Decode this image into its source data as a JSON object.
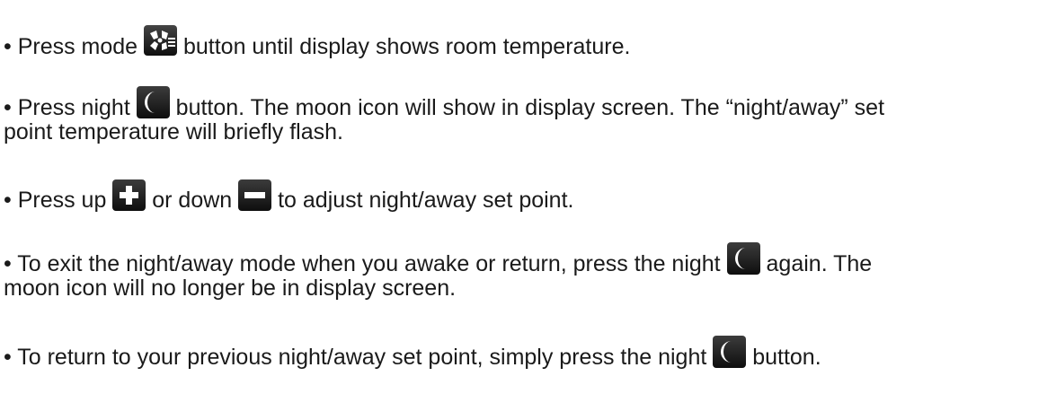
{
  "bullets": [
    {
      "prefix": "• Press mode ",
      "icon": "fan-icon",
      "suffix": " button until display shows room temperature."
    },
    {
      "prefix": "• Press night ",
      "icon": "moon-icon",
      "suffix": " button. The moon icon will show in display screen. The “night/away” set",
      "line2": "point temperature will briefly flash."
    },
    {
      "prefix": "• Press up ",
      "icon1": "plus-icon",
      "middle": " or down ",
      "icon2": "minus-icon",
      "suffix": " to adjust night/away set point."
    },
    {
      "prefix": "• To exit the night/away mode when you awake or return, press the night ",
      "icon": "moon-icon",
      "suffix": " again. The",
      "line2": "moon icon will no longer be in display screen."
    },
    {
      "prefix": "• To return to your previous night/away set point, simply press the night ",
      "icon": "moon-icon",
      "suffix": " button."
    }
  ]
}
